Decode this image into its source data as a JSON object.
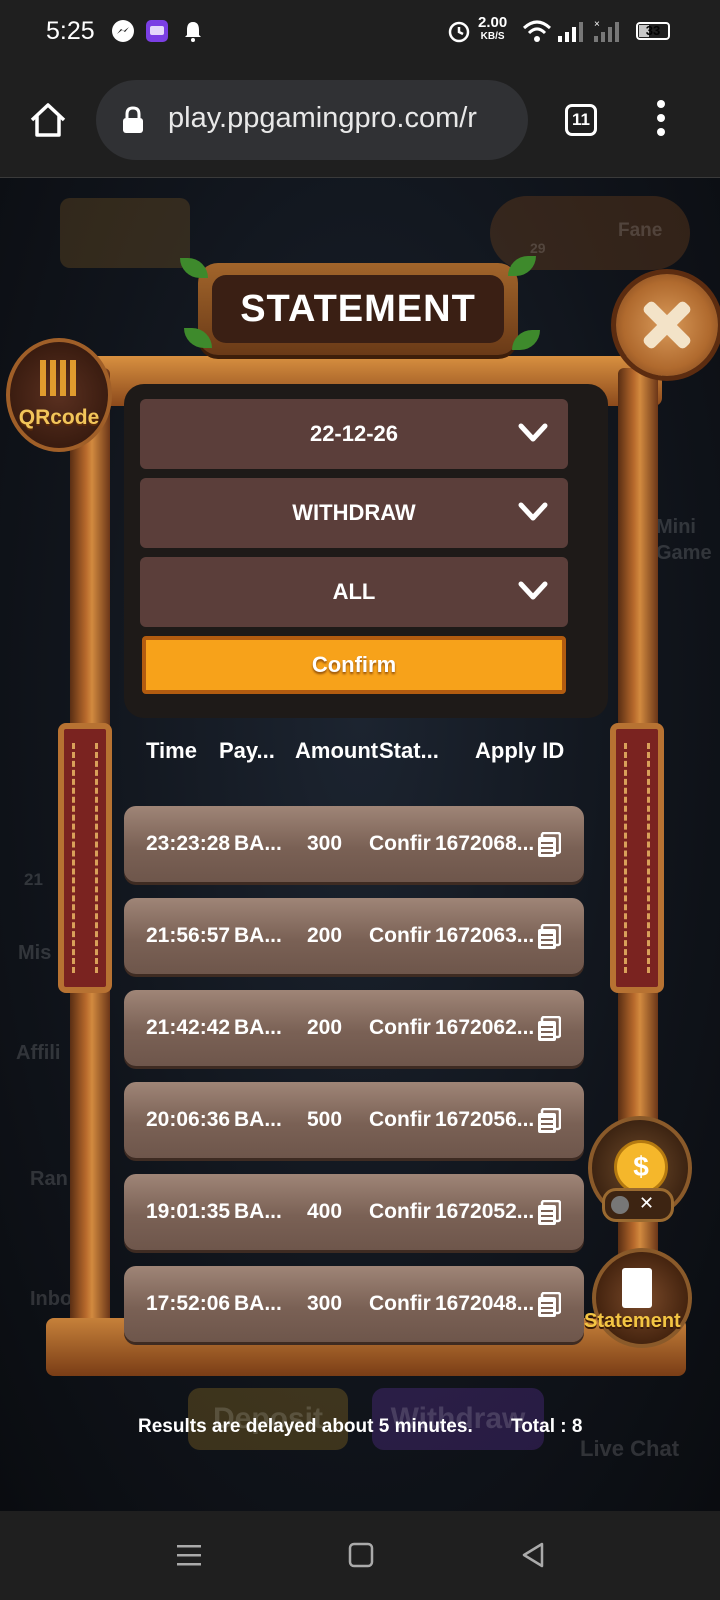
{
  "status_bar": {
    "time": "5:25",
    "net_speed_value": "2.00",
    "net_speed_unit": "KB/S",
    "battery": "33"
  },
  "browser": {
    "url": "play.ppgamingpro.com/r",
    "tab_count": "11"
  },
  "game_bg": {
    "fame_label": "Fane",
    "mini_game_label": "Mini Game",
    "badge_count": "21",
    "level": "29",
    "deposit_label": "Deposit",
    "withdraw_label": "Withdraw",
    "live_chat_label": "Live Chat",
    "side_labels": [
      "Mis",
      "Affili",
      "Ran",
      "Inbo"
    ]
  },
  "dialog": {
    "title": "STATEMENT",
    "qr_label": "QRcode",
    "filters": {
      "date": "22-12-26",
      "type": "WITHDRAW",
      "status": "ALL"
    },
    "confirm_label": "Confirm",
    "columns": [
      "Time",
      "Pay...",
      "Amount",
      "Stat...",
      "Apply ID"
    ],
    "rows": [
      {
        "time": "23:23:28",
        "pay": "BA...",
        "amount": "300",
        "status": "Confir",
        "apply_id": "1672068..."
      },
      {
        "time": "21:56:57",
        "pay": "BA...",
        "amount": "200",
        "status": "Confir",
        "apply_id": "1672063..."
      },
      {
        "time": "21:42:42",
        "pay": "BA...",
        "amount": "200",
        "status": "Confir",
        "apply_id": "1672062..."
      },
      {
        "time": "20:06:36",
        "pay": "BA...",
        "amount": "500",
        "status": "Confir",
        "apply_id": "1672056..."
      },
      {
        "time": "19:01:35",
        "pay": "BA...",
        "amount": "400",
        "status": "Confir",
        "apply_id": "1672052..."
      },
      {
        "time": "17:52:06",
        "pay": "BA...",
        "amount": "300",
        "status": "Confir",
        "apply_id": "1672048..."
      }
    ],
    "delay_note": "Results are delayed about 5 minutes.",
    "total": "Total : 8"
  },
  "floating": {
    "statement_label": "Statement",
    "coin_symbol": "$",
    "toggle_close": "✕"
  },
  "colors": {
    "accent_orange": "#f7a21a",
    "row_brown": "#7a6155",
    "dropdown": "#5b3e3a"
  }
}
